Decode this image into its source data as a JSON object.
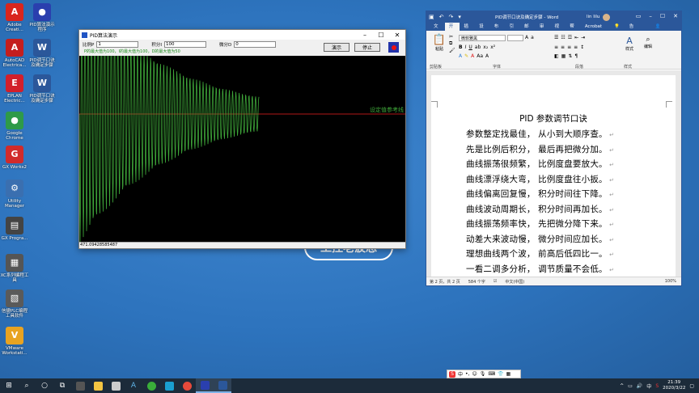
{
  "desktop": {
    "background_logo": "工控老波总",
    "icons": [
      {
        "label": "Adobe Creati...",
        "icon": "adobe-icon",
        "color": "#d9251d",
        "glyph": "A"
      },
      {
        "label": "AutoCAD Electrica...",
        "icon": "autocad-icon",
        "color": "#c41e1e",
        "glyph": "A"
      },
      {
        "label": "EPLAN Electric...",
        "icon": "eplan-icon",
        "color": "#d21f2b",
        "glyph": "E"
      },
      {
        "label": "Google Chrome",
        "icon": "chrome-icon",
        "color": "#2e9a49",
        "glyph": "●"
      },
      {
        "label": "GX Works2",
        "icon": "gxworks-icon",
        "color": "#d12b2b",
        "glyph": "G"
      },
      {
        "label": "Utility Manager",
        "icon": "utility-icon",
        "color": "#3a6fb0",
        "glyph": "⚙"
      },
      {
        "label": "GX Progra...",
        "icon": "gxprog-icon",
        "color": "#444444",
        "glyph": "▤"
      },
      {
        "label": "XC系列编程工具",
        "icon": "xc-tool-icon",
        "color": "#555555",
        "glyph": "▦"
      },
      {
        "label": "信捷PLC编程工具软件",
        "icon": "xinje-icon",
        "color": "#5a5a5a",
        "glyph": "▧"
      },
      {
        "label": "VMware Workstati...",
        "icon": "vmware-icon",
        "color": "#e8a321",
        "glyph": "V"
      }
    ],
    "icons_col2": [
      {
        "label": "PID算法演示程序",
        "icon": "pid-app-icon",
        "color": "#2a3fae",
        "glyph": "●"
      },
      {
        "label": "PID调节口诀及确定步骤",
        "icon": "word-doc-icon",
        "color": "#2b579a",
        "glyph": "W"
      },
      {
        "label": "PID调节口诀及确定步骤",
        "icon": "word-doc-icon",
        "color": "#2b579a",
        "glyph": "W"
      }
    ]
  },
  "pid_window": {
    "title": "PID算法演示",
    "params": {
      "p_label": "比例P",
      "p_value": "1",
      "i_label": "积分I",
      "i_value": "100",
      "d_label": "微分D",
      "d_value": "0"
    },
    "limits_text": "P的最大值为100，I的最大值为100，D的最大值为50",
    "demo_button": "演示",
    "stop_button": "停止",
    "setpoint_label": "设定值参考线",
    "status_value": "471.09428585487",
    "plot_colors": {
      "background": "#000000",
      "curve": "#3fa83a",
      "setpoint": "#b01818"
    }
  },
  "word": {
    "filename": "PID调节口诀及确定步骤 - Word",
    "user": "lin lilu",
    "tabs": [
      "文件",
      "开始",
      "插入",
      "设计",
      "布局",
      "引用",
      "邮件",
      "审阅",
      "视图",
      "帮助",
      "Acrobat"
    ],
    "active_tab": "开始",
    "tell_me": "告诉我",
    "share": "共享",
    "ribbon": {
      "paste": "粘贴",
      "clipboard": "剪贴板",
      "font_name": "微软雅黑",
      "font_group": "字体",
      "paragraph_group": "段落",
      "styles": "样式",
      "styles_group": "样式",
      "editing": "编辑"
    },
    "doc": {
      "title": "PID 参数调节口诀",
      "lines": [
        "参数整定找最佳，  从小到大顺序查。",
        "先是比例后积分，  最后再把微分加。",
        "曲线振荡很频繁，  比例度盘要放大。",
        "曲线漂浮绕大弯，  比例度盘往小扳。",
        "曲线偏离回复慢，  积分时间往下降。",
        "曲线波动周期长，  积分时间再加长。",
        "曲线振荡频率快，  先把微分降下来。",
        "动差大来波动慢，  微分时间应加长。",
        "理想曲线两个波，  前高后低四比一。",
        "一看二调多分析，  调节质量不会低。"
      ]
    },
    "status": {
      "page": "第 2 页，共 2 页",
      "words": "584 个字",
      "lang": "中文(中国)",
      "zoom": "100%"
    }
  },
  "ime": {
    "label": "中"
  },
  "taskbar": {
    "time": "21:39",
    "date": "2020/3/22",
    "lang": "中"
  }
}
